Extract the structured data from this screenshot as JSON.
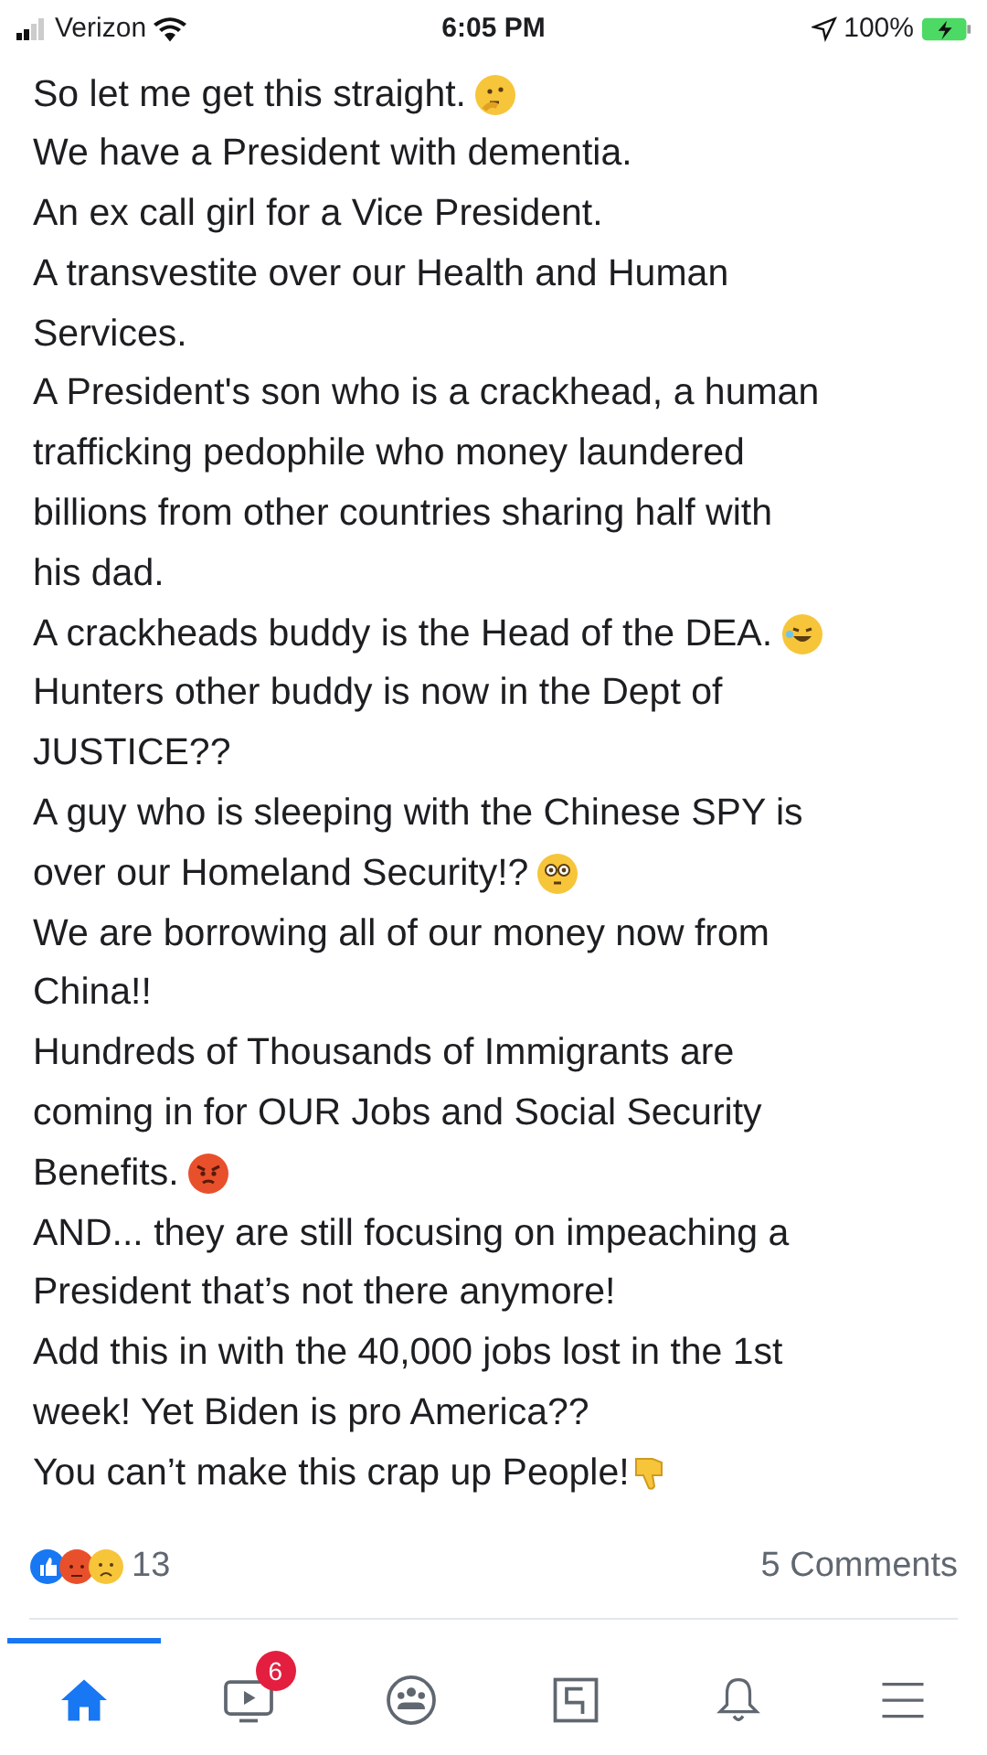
{
  "status_bar": {
    "carrier": "Verizon",
    "time": "6:05 PM",
    "battery": "100%"
  },
  "post": {
    "lines": [
      {
        "text": "So let me get this straight.",
        "kind": "thinking"
      },
      {
        "text": "We have a President with dementia.",
        "kind": "plain"
      },
      {
        "text": "An ex call girl for a Vice President.",
        "kind": "plain"
      },
      {
        "text": "A transvestite over our Health and Human",
        "kind": "plain"
      },
      {
        "text": "Services.",
        "kind": "plain"
      },
      {
        "text": "A President's son who is a crackhead, a human",
        "kind": "plain"
      },
      {
        "text": "trafficking pedophile who money laundered",
        "kind": "plain"
      },
      {
        "text": "billions from other countries sharing half with",
        "kind": "plain"
      },
      {
        "text": "his dad.",
        "kind": "plain"
      },
      {
        "text": "A crackheads buddy is the Head of the DEA.",
        "kind": "laughing"
      },
      {
        "text": "Hunters other buddy is now in the Dept of",
        "kind": "plain"
      },
      {
        "text": "JUSTICE??",
        "kind": "plain"
      },
      {
        "text": "A guy who is sleeping with the Chinese SPY is",
        "kind": "plain"
      },
      {
        "text": "over our Homeland Security!?",
        "kind": "flushed"
      },
      {
        "text": "We are borrowing all of our money now from",
        "kind": "plain"
      },
      {
        "text": "China!!",
        "kind": "plain"
      },
      {
        "text": "Hundreds of Thousands of Immigrants are",
        "kind": "plain"
      },
      {
        "text": "coming in for OUR Jobs and Social Security",
        "kind": "plain"
      },
      {
        "text": "Benefits.",
        "kind": "angry"
      },
      {
        "text": "AND... they are still focusing on impeaching a",
        "kind": "plain"
      },
      {
        "text": "President that’s not there anymore!",
        "kind": "plain"
      },
      {
        "text": "Add this in with the 40,000 jobs lost in the 1st",
        "kind": "plain"
      },
      {
        "text": "week! Yet Biden is pro America??",
        "kind": "plain"
      },
      {
        "text": "You can’t make this crap up People!",
        "kind": "thumbsdown"
      }
    ],
    "reaction_count": "13",
    "comments": "5 Comments"
  },
  "nav": [
    {
      "kind": "home",
      "selected": true
    },
    {
      "kind": "watch",
      "selected": false,
      "badge": "6"
    },
    {
      "kind": "groups",
      "selected": false
    },
    {
      "kind": "gaming",
      "selected": false
    },
    {
      "kind": "bell",
      "selected": false
    },
    {
      "kind": "menu",
      "selected": false
    }
  ]
}
